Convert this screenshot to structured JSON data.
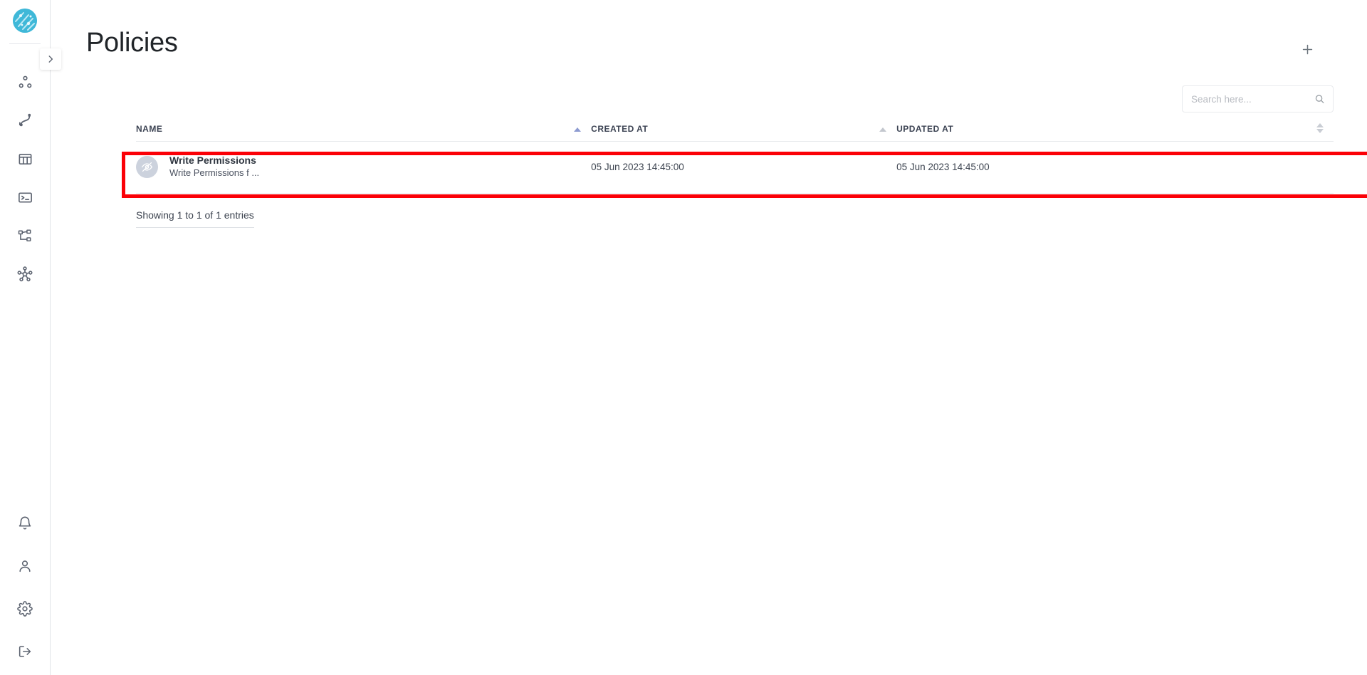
{
  "app": {
    "logo_name": "brand-logo"
  },
  "sidebar": {
    "expand_toggle_icon": "chevron-right-icon",
    "top_items": [
      {
        "icon": "nodes-graph-icon",
        "label": "Nodes"
      },
      {
        "icon": "connections-icon",
        "label": "Connections"
      },
      {
        "icon": "table-icon",
        "label": "Tables"
      },
      {
        "icon": "terminal-icon",
        "label": "Console"
      },
      {
        "icon": "sitemap-icon",
        "label": "Schemas"
      },
      {
        "icon": "network-hub-icon",
        "label": "Network"
      }
    ],
    "bottom_items": [
      {
        "icon": "bell-icon",
        "label": "Notifications"
      },
      {
        "icon": "user-icon",
        "label": "Account"
      },
      {
        "icon": "gear-icon",
        "label": "Settings"
      },
      {
        "icon": "logout-icon",
        "label": "Log out"
      }
    ]
  },
  "header": {
    "title": "Policies",
    "add_button_icon": "plus-icon",
    "add_button_label": "+"
  },
  "search": {
    "placeholder": "Search here...",
    "value": "",
    "icon": "search-icon"
  },
  "table": {
    "columns": [
      {
        "key": "name",
        "label": "NAME",
        "sort": "asc-active"
      },
      {
        "key": "created_at",
        "label": "CREATED AT",
        "sort": "asc-gray"
      },
      {
        "key": "updated_at",
        "label": "UPDATED AT",
        "sort": "none"
      },
      {
        "key": "actions",
        "label": "",
        "sort": "both"
      }
    ],
    "rows": [
      {
        "avatar_icon": "eye-off-icon",
        "name": "Write Permissions",
        "description": "Write Permissions f ...",
        "created_at": "05 Jun 2023 14:45:00",
        "updated_at": "05 Jun 2023 14:45:00"
      }
    ],
    "footer": "Showing 1 to 1 of 1 entries"
  },
  "annotation": {
    "highlight_color": "#fb0007",
    "highlight_target": "policy-row-write-permissions"
  }
}
